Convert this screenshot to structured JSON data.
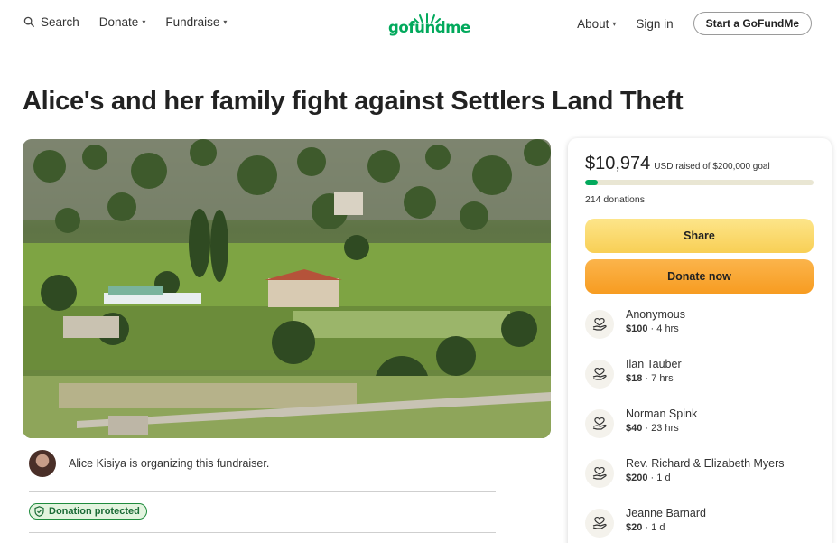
{
  "nav": {
    "search": "Search",
    "donate": "Donate",
    "fundraise": "Fundraise",
    "about": "About",
    "sign_in": "Sign in",
    "start": "Start a GoFundMe",
    "logo": "gofundme"
  },
  "campaign": {
    "title": "Alice's and her family fight against Settlers Land Theft",
    "organizer_text": "Alice Kisiya is organizing this fundraiser.",
    "protected_label": "Donation protected"
  },
  "panel": {
    "raised_amount": "$10,974",
    "raised_label": "USD raised of $200,000 goal",
    "progress_fraction": 0.055,
    "donations_count": "214 donations",
    "share_label": "Share",
    "donate_label": "Donate now",
    "donors": [
      {
        "name": "Anonymous",
        "amount": "$100",
        "time": "4 hrs"
      },
      {
        "name": "Ilan Tauber",
        "amount": "$18",
        "time": "7 hrs"
      },
      {
        "name": "Norman Spink",
        "amount": "$40",
        "time": "23 hrs"
      },
      {
        "name": "Rev. Richard & Elizabeth Myers",
        "amount": "$200",
        "time": "1 d"
      },
      {
        "name": "Jeanne Barnard",
        "amount": "$20",
        "time": "1 d"
      }
    ]
  },
  "colors": {
    "brand_green": "#02a95c",
    "share_yellow": "#f8cf55",
    "donate_orange": "#f79c21"
  }
}
